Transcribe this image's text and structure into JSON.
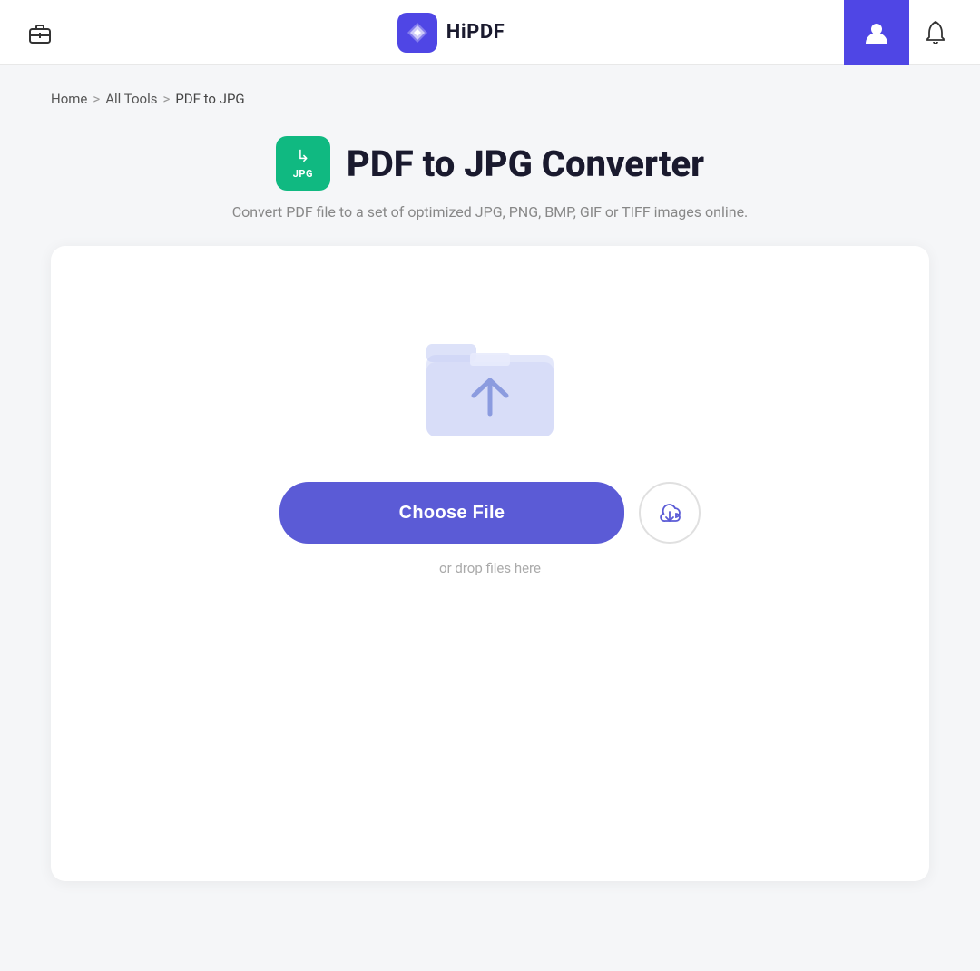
{
  "header": {
    "brand": "HiPDF",
    "toolbox_label": "Tools",
    "user_label": "User Account",
    "notification_label": "Notifications"
  },
  "breadcrumb": {
    "home": "Home",
    "sep1": ">",
    "all_tools": "All Tools",
    "sep2": ">",
    "current": "PDF to JPG"
  },
  "converter": {
    "icon_arrow": "↳",
    "icon_label": "JPG",
    "title": "PDF to JPG Converter",
    "subtitle": "Convert PDF file to a set of optimized JPG, PNG, BMP, GIF or TIFF images online."
  },
  "upload": {
    "choose_file_label": "Choose File",
    "drop_hint": "or drop files here"
  },
  "colors": {
    "accent": "#5b5bd6",
    "green": "#10b981",
    "header_accent": "#4f46e5"
  }
}
